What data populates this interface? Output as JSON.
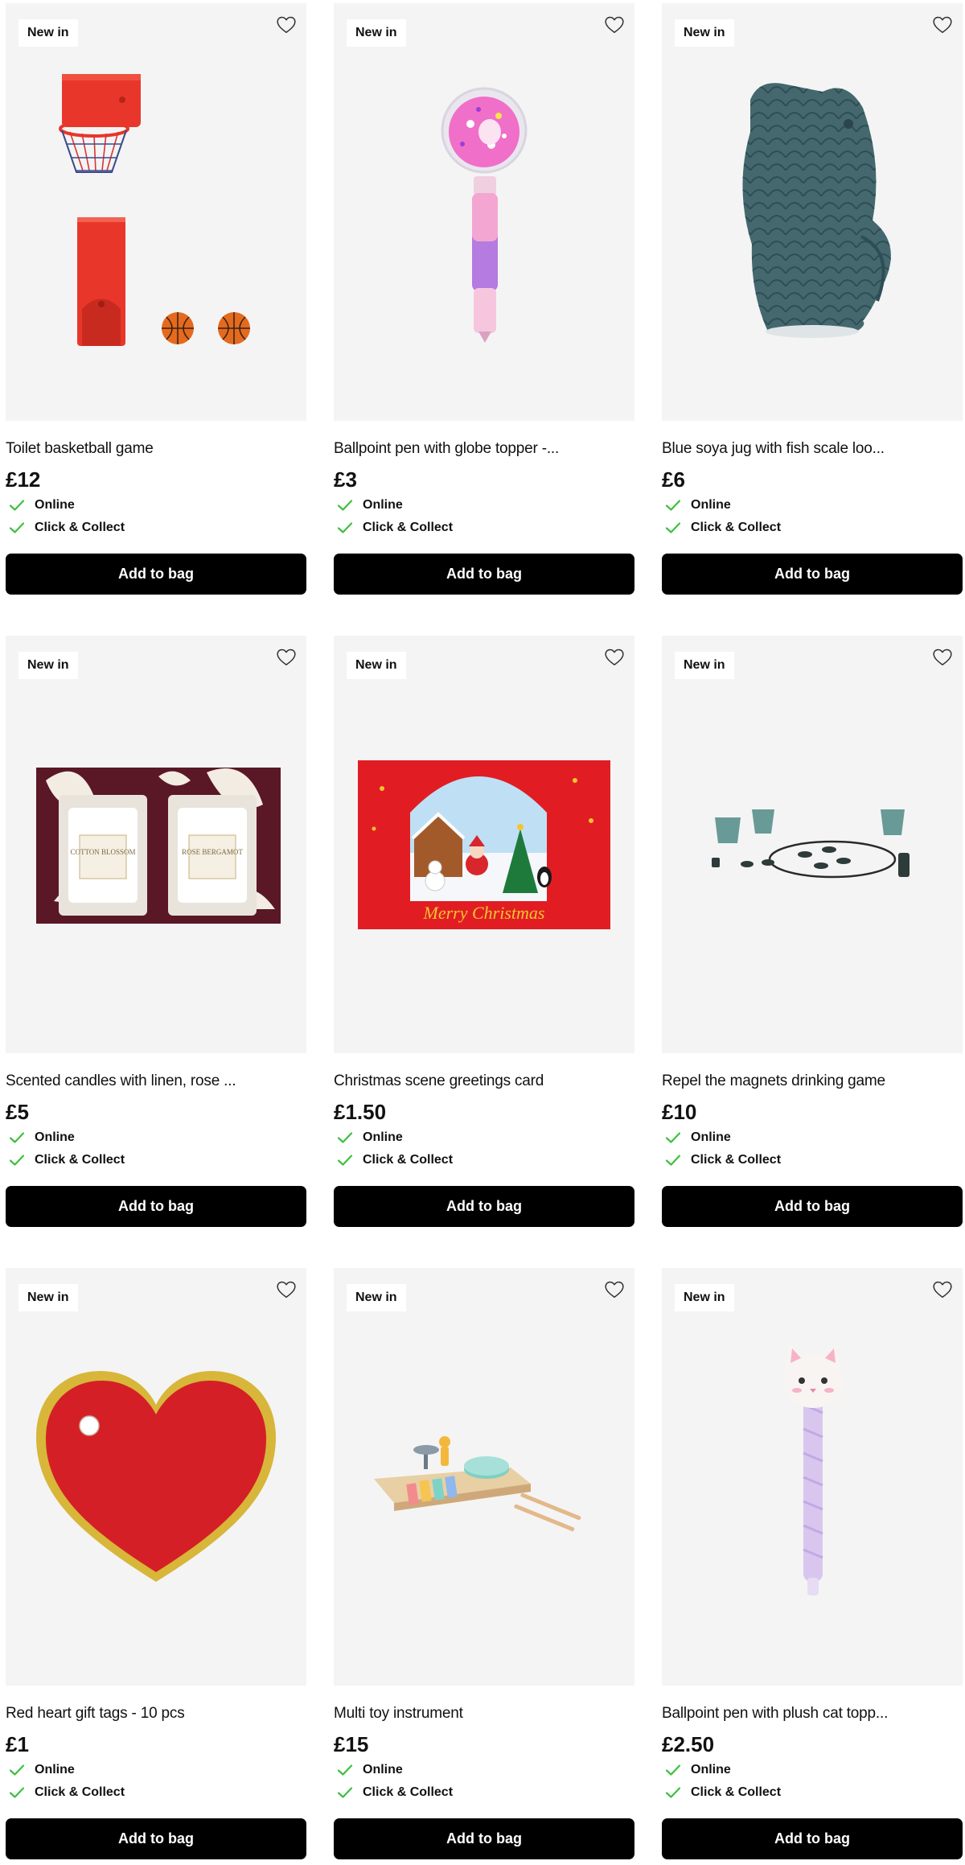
{
  "colors": {
    "accent_check": "#3fbf3f",
    "button_bg": "#000000",
    "tile_bg": "#f4f4f4"
  },
  "products": [
    {
      "badge": "New in",
      "title": "Toilet basketball game",
      "price": "£12",
      "availability": [
        "Online",
        "Click & Collect"
      ],
      "button": "Add to bag",
      "image": "toilet-basketball-game",
      "favourite_icon": "heart-outline-icon"
    },
    {
      "badge": "New in",
      "title": "Ballpoint pen with globe topper -...",
      "price": "£3",
      "availability": [
        "Online",
        "Click & Collect"
      ],
      "button": "Add to bag",
      "image": "globe-pen",
      "favourite_icon": "heart-outline-icon"
    },
    {
      "badge": "New in",
      "title": "Blue soya jug with fish scale loo...",
      "price": "£6",
      "availability": [
        "Online",
        "Click & Collect"
      ],
      "button": "Add to bag",
      "image": "fish-jug",
      "favourite_icon": "heart-outline-icon"
    },
    {
      "badge": "New in",
      "title": "Scented candles with linen, rose ...",
      "price": "£5",
      "availability": [
        "Online",
        "Click & Collect"
      ],
      "button": "Add to bag",
      "image": "scented-candles",
      "favourite_icon": "heart-outline-icon",
      "image_text": [
        "COTTON BLOSSOM",
        "ROSE BERGAMOT"
      ]
    },
    {
      "badge": "New in",
      "title": "Christmas scene greetings card",
      "price": "£1.50",
      "availability": [
        "Online",
        "Click & Collect"
      ],
      "button": "Add to bag",
      "image": "christmas-card",
      "favourite_icon": "heart-outline-icon",
      "image_text": [
        "Merry Christmas"
      ]
    },
    {
      "badge": "New in",
      "title": "Repel the magnets drinking game",
      "price": "£10",
      "availability": [
        "Online",
        "Click & Collect"
      ],
      "button": "Add to bag",
      "image": "magnets-game",
      "favourite_icon": "heart-outline-icon"
    },
    {
      "badge": "New in",
      "title": "Red heart gift tags - 10 pcs",
      "price": "£1",
      "availability": [
        "Online",
        "Click & Collect"
      ],
      "button": "Add to bag",
      "image": "heart-gift-tag",
      "favourite_icon": "heart-outline-icon"
    },
    {
      "badge": "New in",
      "title": "Multi toy instrument",
      "price": "£15",
      "availability": [
        "Online",
        "Click & Collect"
      ],
      "button": "Add to bag",
      "image": "toy-instrument",
      "favourite_icon": "heart-outline-icon"
    },
    {
      "badge": "New in",
      "title": "Ballpoint pen with plush cat topp...",
      "price": "£2.50",
      "availability": [
        "Online",
        "Click & Collect"
      ],
      "button": "Add to bag",
      "image": "cat-pen",
      "favourite_icon": "heart-outline-icon"
    }
  ]
}
